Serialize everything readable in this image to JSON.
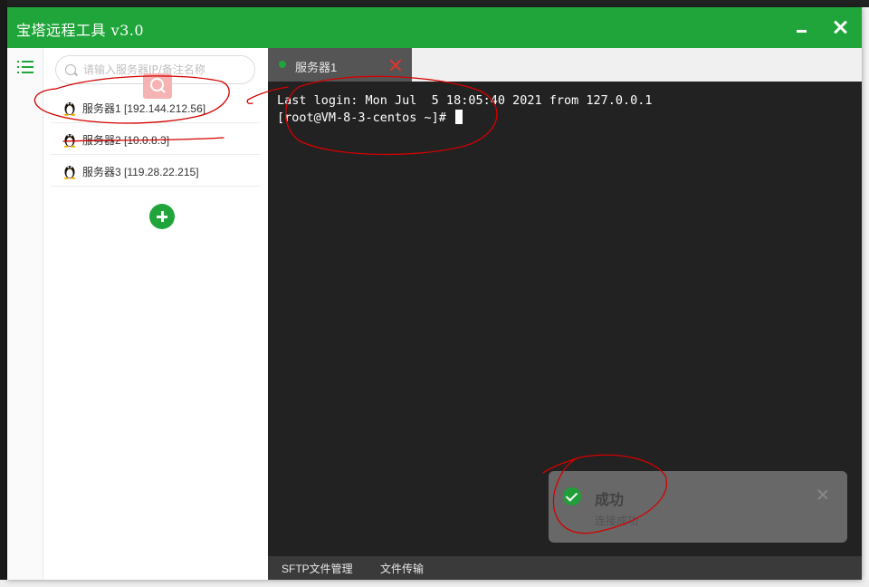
{
  "app": {
    "title": "宝塔远程工具 v3.0",
    "accent_color": "#20a53a",
    "window_controls": [
      "minimize-icon",
      "close-icon"
    ]
  },
  "sidebar": {
    "menu_icon": "list-icon",
    "search": {
      "placeholder": "请输入服务器IP/备注名称",
      "value": ""
    },
    "servers": [
      {
        "label": "服务器1 [192.144.212.56]",
        "os_icon": "linux-penguin-icon"
      },
      {
        "label": "服务器2 [10.0.8.3]",
        "os_icon": "linux-penguin-icon"
      },
      {
        "label": "服务器3 [119.28.22.215]",
        "os_icon": "linux-penguin-icon"
      }
    ],
    "add_icon": "plus-circle-icon"
  },
  "tabs": [
    {
      "label": "服务器1",
      "status_color": "#20a53a",
      "close_icon": "close-icon"
    }
  ],
  "terminal": {
    "lines": [
      "Last login: Mon Jul  5 18:05:40 2021 from 127.0.0.1",
      "[root@VM-8-3-centos ~]# "
    ]
  },
  "bottom_tabs": [
    "SFTP文件管理",
    "文件传输"
  ],
  "toast": {
    "icon": "check-circle-icon",
    "title": "成功",
    "message": "连接成功"
  },
  "annotation_color": "#d40000"
}
